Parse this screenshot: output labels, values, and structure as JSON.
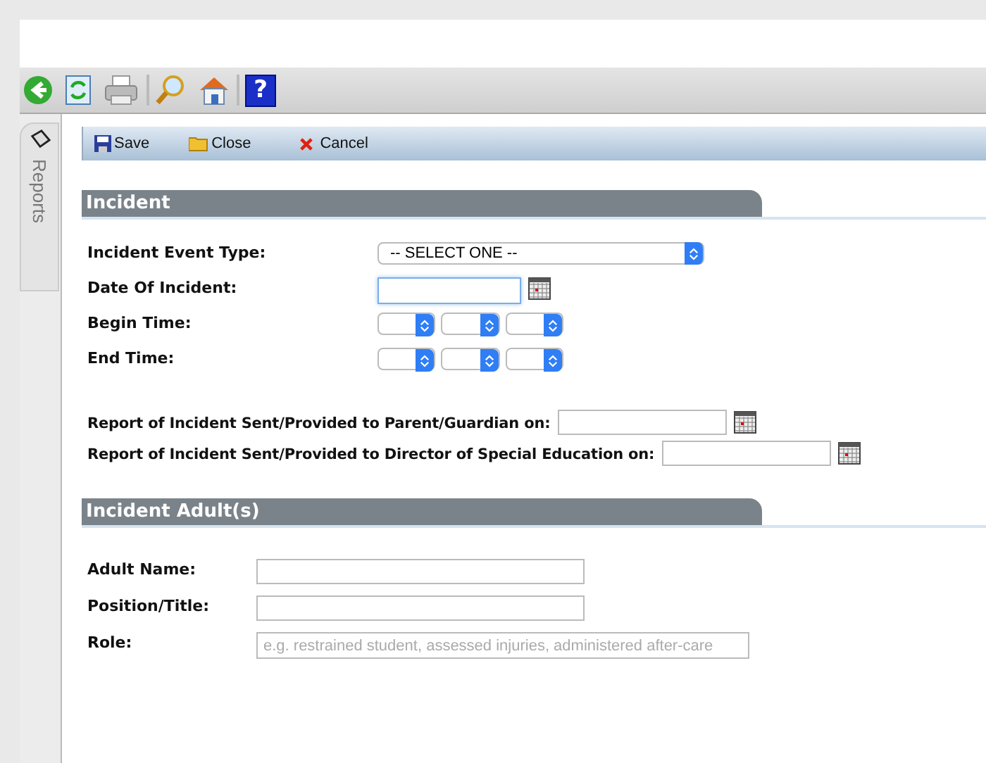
{
  "toolbar": [
    {
      "kind": "back"
    },
    {
      "kind": "refresh"
    },
    {
      "kind": "print"
    },
    {
      "kind": "search"
    },
    {
      "kind": "home"
    },
    {
      "kind": "help",
      "glyph": "?"
    }
  ],
  "side_tab": {
    "label": "Reports"
  },
  "actions": [
    {
      "kind": "save",
      "label": "Save"
    },
    {
      "kind": "close",
      "label": "Close"
    },
    {
      "kind": "cancel",
      "label": "Cancel"
    }
  ],
  "sections": [
    {
      "title": "Incident",
      "rows": [
        {
          "kind": "select",
          "label": "Incident Event Type:",
          "value": "-- SELECT ONE --"
        },
        {
          "kind": "date",
          "label": "Date Of Incident:",
          "focused": true
        },
        {
          "kind": "time",
          "label": "Begin Time:"
        },
        {
          "kind": "time",
          "label": "End Time:"
        },
        {
          "kind": "report",
          "label": "Report of Incident Sent/Provided to Parent/Guardian on:"
        },
        {
          "kind": "report",
          "label": "Report of Incident Sent/Provided to Director of Special Education on:"
        }
      ]
    },
    {
      "title": "Incident Adult(s)",
      "rows": [
        {
          "kind": "text",
          "label": "Adult Name:"
        },
        {
          "kind": "text",
          "label": "Position/Title:"
        },
        {
          "kind": "wide",
          "label": "Role:",
          "placeholder": "e.g. restrained student, assessed injuries, administered after-care"
        }
      ]
    }
  ]
}
